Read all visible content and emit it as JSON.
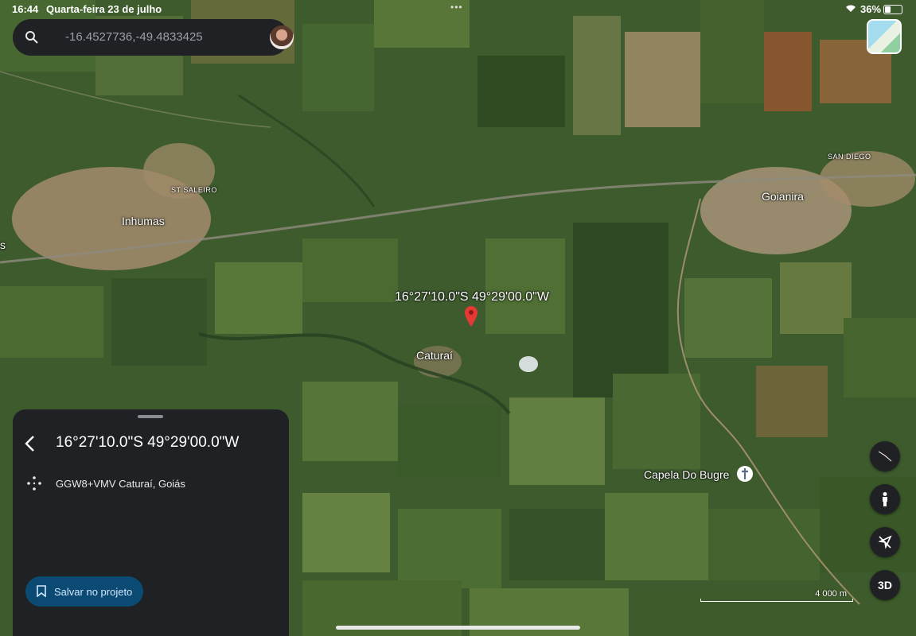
{
  "status_bar": {
    "time": "16:44",
    "date": "Quarta-feira 23 de julho",
    "battery": "36%",
    "dots": "•••"
  },
  "search": {
    "value": "-16.4527736,-49.4833425",
    "icon": "search-icon"
  },
  "map": {
    "labels": {
      "inhumas": "Inhumas",
      "st_saleiro": "ST SALEIRO",
      "goianira": "Goianira",
      "san_diego": "SAN DIEGO",
      "caturai": "Caturaí",
      "capela": "Capela Do Bugre",
      "edge_s": "s"
    },
    "pin_label": "16°27'10.0\"S 49°29'00.0\"W",
    "scale_label": "4 000 m"
  },
  "panel": {
    "title": "16°27'10.0\"S 49°29'00.0\"W",
    "plus_code": "GGW8+VMV Caturaí, Goiás",
    "save_label": "Salvar no projeto"
  },
  "controls": {
    "btn_3d": "3D"
  },
  "colors": {
    "panel_bg": "#1f2124",
    "save_bg": "#0b4a73",
    "pin": "#e53935"
  }
}
